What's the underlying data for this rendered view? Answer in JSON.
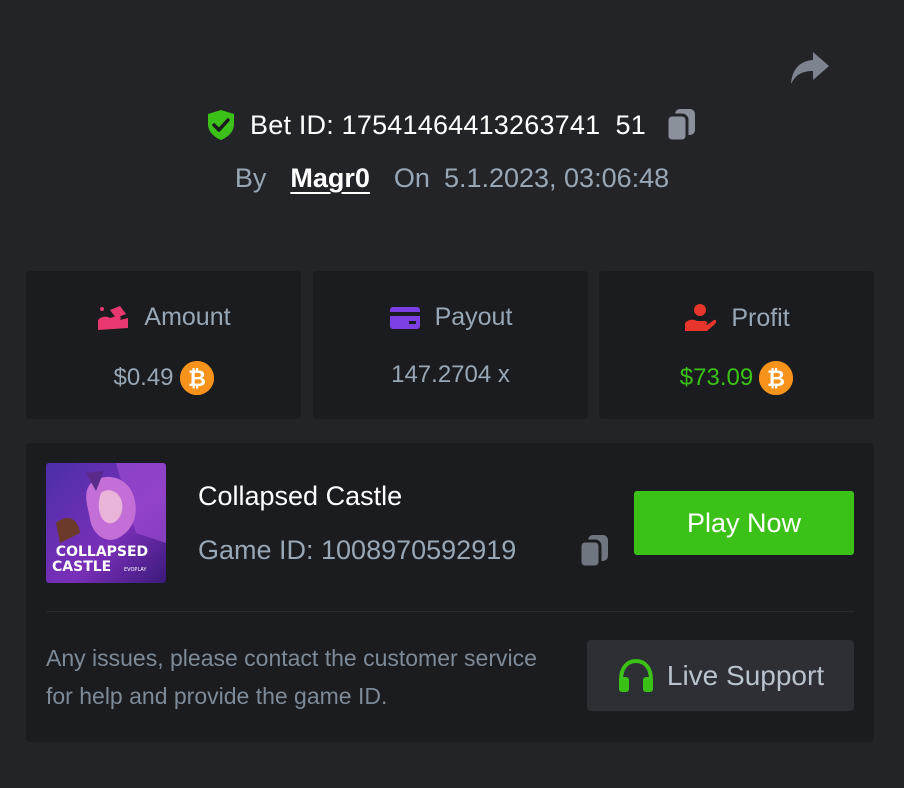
{
  "bet": {
    "id_text": "Bet ID: 17541464413263741 51",
    "by_label": "By",
    "user": "Magr0",
    "on_label": "On",
    "datetime": "5.1.2023, 03:06:48"
  },
  "stats": {
    "amount": {
      "label": "Amount",
      "value": "$0.49"
    },
    "payout": {
      "label": "Payout",
      "value": "147.2704 x"
    },
    "profit": {
      "label": "Profit",
      "value": "$73.09"
    }
  },
  "game": {
    "title": "Collapsed Castle",
    "id_text": "Game ID: 1008970592919",
    "thumb_line1": "COLLAPSED",
    "thumb_line2": "CASTLE",
    "thumb_brand": "EVOPLAY",
    "play_label": "Play Now",
    "help_text": "Any issues, please contact the customer service for help and provide the game ID.",
    "support_label": "Live Support"
  },
  "icons": {
    "share": "share-arrow-icon",
    "verified": "shield-check-icon",
    "copy": "copy-icon",
    "amount": "amount-icon",
    "payout": "card-icon",
    "profit": "profit-hand-icon",
    "coin": "bitcoin-icon",
    "support": "headset-icon"
  },
  "colors": {
    "background": "#232428",
    "card": "#1b1c1f",
    "accent_green": "#3bc117",
    "muted_text": "#98a7b5",
    "amount_icon": "#e8386f",
    "payout_icon": "#7b3fe4",
    "profit_icon": "#e8352c",
    "bitcoin": "#f7931a"
  }
}
